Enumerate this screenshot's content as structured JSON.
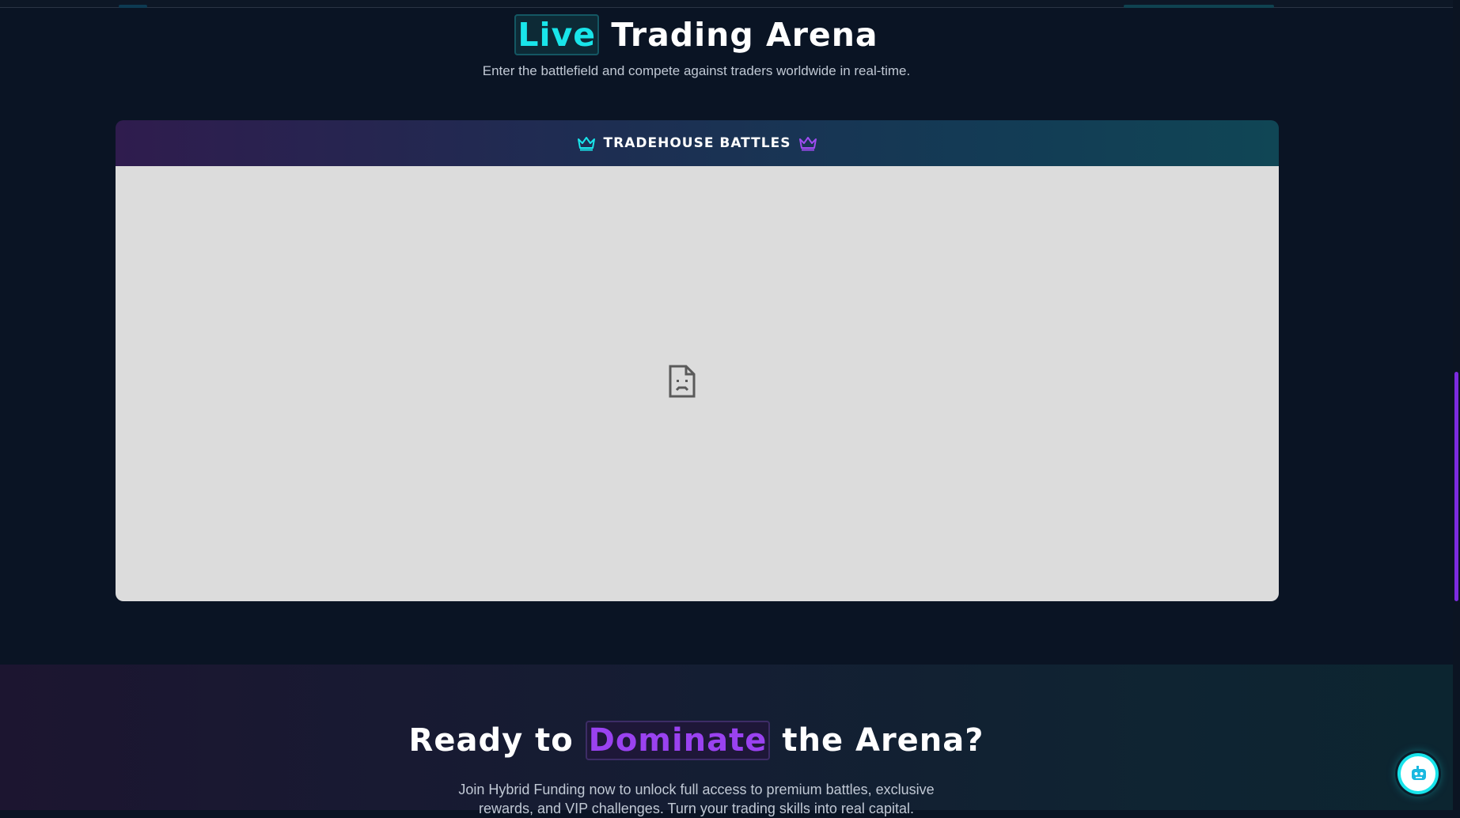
{
  "arena": {
    "title_highlight": "Live",
    "title_rest": "Trading Arena",
    "subtitle": "Enter the battlefield and compete against traders worldwide in real-time."
  },
  "battles_panel": {
    "header_label": "TRADEHOUSE BATTLES",
    "header_icon_left": "crown-icon",
    "header_icon_right": "crown-icon",
    "embed_state_icon": "broken-document-icon"
  },
  "cta": {
    "title_before": "Ready to",
    "title_highlight": "Dominate",
    "title_after": "the Arena?",
    "text": "Join Hybrid Funding now to unlock full access to premium battles, exclusive rewards, and VIP challenges. Turn your trading skills into real capital."
  },
  "chat_widget": {
    "icon": "chat-bot-icon"
  },
  "colors": {
    "accent_cyan": "#19e5ea",
    "accent_purple": "#9a42f0",
    "background": "#0a1424"
  }
}
